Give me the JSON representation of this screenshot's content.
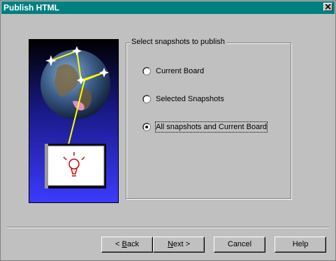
{
  "window": {
    "title": "Publish HTML"
  },
  "group": {
    "legend": "Select snapshots to publish",
    "options": [
      {
        "label": "Current Board",
        "selected": false
      },
      {
        "label": "Selected Snapshots",
        "selected": false
      },
      {
        "label": "All snapshots and Current Board",
        "selected": true
      }
    ]
  },
  "buttons": {
    "back": {
      "accel": "B",
      "rest": "ack",
      "prefix": "< "
    },
    "next": {
      "accel": "N",
      "rest": "ext >"
    },
    "cancel": "Cancel",
    "help": "Help"
  },
  "colors": {
    "titlebar": "#008080",
    "dialog": "#c0c0c0"
  },
  "icons": {
    "close": "close-icon",
    "illustration": "globe-lightbulb-illustration"
  }
}
